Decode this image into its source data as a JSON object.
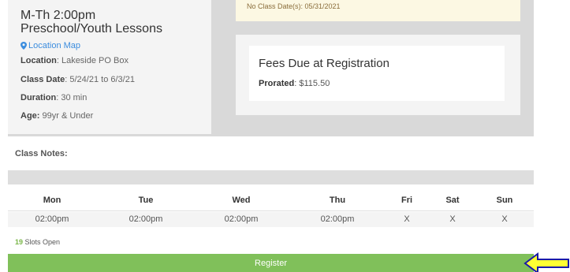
{
  "class_card": {
    "title_line1": "M-Th 2:00pm",
    "title_line2": "Preschool/Youth Lessons",
    "location_map": "Location Map",
    "location_label": "Location",
    "location_value": ": Lakeside PO Box",
    "class_date_label": "Class Date",
    "class_date_value": ": 5/24/21 to 6/3/21",
    "duration_label": "Duration",
    "duration_value": ": 30 min",
    "age_label": "Age:",
    "age_value": " 99yr & Under"
  },
  "alert": {
    "text": "No Class Date(s): 05/31/2021"
  },
  "fees": {
    "title": "Fees Due at Registration",
    "prorated_label": "Prorated",
    "prorated_value": ": $115.50"
  },
  "class_notes": {
    "label": "Class Notes:"
  },
  "schedule": {
    "days": [
      "Mon",
      "Tue",
      "Wed",
      "Thu",
      "Fri",
      "Sat",
      "Sun"
    ],
    "times": [
      "02:00pm",
      "02:00pm",
      "02:00pm",
      "02:00pm",
      "X",
      "X",
      "X"
    ]
  },
  "slots": {
    "count": "19",
    "label": " Slots Open"
  },
  "register": {
    "label": "Register"
  },
  "colors": {
    "register_green": "#80c05a",
    "link_blue": "#3c8dde",
    "arrow_yellow": "#ffff33",
    "arrow_outline": "#1a1aa8"
  },
  "icons": {
    "location": "map-marker-icon",
    "pointer": "left-arrow-icon"
  }
}
